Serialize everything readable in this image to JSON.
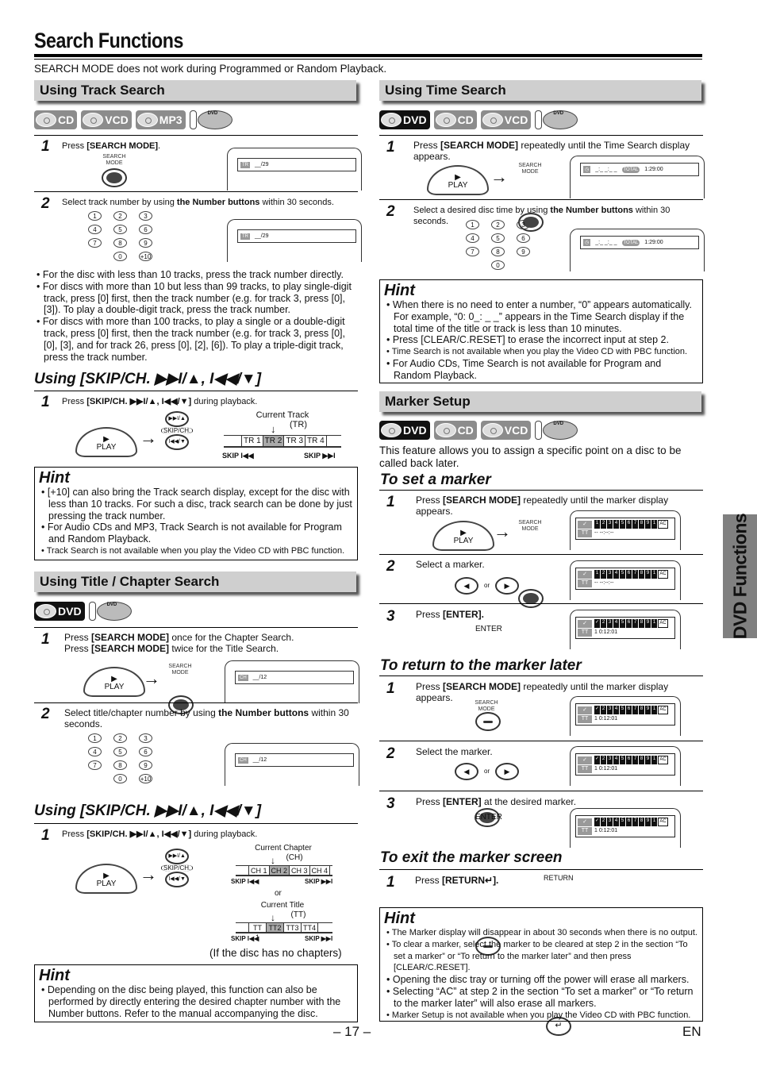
{
  "page": {
    "title": "Search Functions",
    "intro": "SEARCH MODE does not work during Programmed or Random Playback.",
    "side_tab": "DVD Functions",
    "page_number": "– 17 –",
    "language": "EN"
  },
  "discs": {
    "dvd": "DVD",
    "cd": "CD",
    "vcd": "VCD",
    "mp3": "MP3",
    "pad_label": "DVD"
  },
  "buttons": {
    "search_mode": "SEARCH MODE",
    "play": "PLAY",
    "enter": "ENTER",
    "return": "RETURN",
    "skip_ch": "SKIP/CH.",
    "skip_next": "▶▶I/▲",
    "skip_prev": "I◀◀/▼",
    "or": "or",
    "left": "◀",
    "right": "▶",
    "numbers": [
      "1",
      "2",
      "3",
      "4",
      "5",
      "6",
      "7",
      "8",
      "9",
      "0",
      "+10"
    ],
    "numbers_no_plus10": [
      "1",
      "2",
      "3",
      "4",
      "5",
      "6",
      "7",
      "8",
      "9",
      "0"
    ]
  },
  "track_search": {
    "heading": "Using Track Search",
    "step1": {
      "num": "1",
      "text_pre": "Press ",
      "text_bold": "[SEARCH MODE]",
      "text_post": "."
    },
    "step2": {
      "num": "2",
      "text_pre": "Select track number by using ",
      "text_bold": "the Number buttons",
      "text_post": " within 30 seconds."
    },
    "display_tag": "TR",
    "display_value": "__/29",
    "bullets": [
      "For the disc with less than 10 tracks, press the track number directly.",
      "For discs with more than 10 but less than 99 tracks, to play single-digit track, press [0] first, then the track number (e.g. for track 3, press [0], [3]). To play a double-digit track, press the track number.",
      "For discs with more than 100 tracks, to play a single or a double-digit track, press [0] first, then the track number (e.g. for track 3, press [0], [0], [3], and for track 26, press [0], [2], [6]). To play a triple-digit track, press the track number."
    ]
  },
  "skip_track": {
    "heading": "Using [SKIP/CH. ▶▶I/▲, I◀◀/▼]",
    "step1": {
      "num": "1",
      "text_pre": "Press ",
      "text_bold": "[SKIP/CH. ▶▶I/▲, I◀◀/▼]",
      "text_post": " during playback."
    },
    "caption": "Current Track",
    "caption_abbr": "(TR)",
    "cells": [
      "TR 1",
      "TR 2",
      "TR 3",
      "TR 4"
    ],
    "current_index": 1,
    "skip_prev": "SKIP I◀◀",
    "skip_next": "SKIP ▶▶I"
  },
  "hint_track": {
    "title": "Hint",
    "items": [
      "[+10] can also bring the Track search display, except for the disc with less than 10 tracks. For such a disc, track search can be done by just pressing the track number.",
      "For Audio CDs and MP3, Track Search is not available for Program and Random Playback.",
      "Track Search is not available when you play the Video CD with PBC function."
    ]
  },
  "title_chapter": {
    "heading": "Using Title / Chapter Search",
    "step1": {
      "num": "1",
      "line1_pre": "Press ",
      "line1_bold": "[SEARCH MODE]",
      "line1_post": " once for the Chapter Search.",
      "line2_pre": "Press ",
      "line2_bold": "[SEARCH MODE]",
      "line2_post": " twice for the Title Search."
    },
    "step2": {
      "num": "2",
      "text_pre": "Select title/chapter number by using ",
      "text_bold": "the Number buttons",
      "text_post": " within 30 seconds."
    },
    "display_tag": "CH",
    "display_value": "__/12"
  },
  "skip_chapter": {
    "heading": "Using [SKIP/CH. ▶▶I/▲, I◀◀/▼]",
    "step1": {
      "num": "1",
      "text_pre": "Press ",
      "text_bold": "[SKIP/CH. ▶▶I/▲, I◀◀/▼]",
      "text_post": " during playback."
    },
    "chapter_caption": "Current Chapter",
    "chapter_abbr": "(CH)",
    "chapter_cells": [
      "CH 1",
      "CH 2",
      "CH 3",
      "CH 4"
    ],
    "or": "or",
    "title_caption": "Current Title",
    "title_abbr": "(TT)",
    "title_cells": [
      "TT 1",
      "TT2",
      "TT3",
      "TT4"
    ],
    "current_index": 1,
    "skip_prev": "SKIP I◀◀",
    "skip_next": "SKIP ▶▶I",
    "note": "(If the disc has no chapters)"
  },
  "hint_chapter": {
    "title": "Hint",
    "items": [
      "Depending on the disc being played, this function can also be performed by directly entering the desired chapter number with the Number buttons. Refer to the manual accompanying the disc."
    ]
  },
  "time_search": {
    "heading": "Using Time Search",
    "step1": {
      "num": "1",
      "text_pre": "Press ",
      "text_bold": "[SEARCH MODE]",
      "text_post": " repeatedly until the Time Search display appears."
    },
    "step2": {
      "num": "2",
      "text_pre": "Select a desired disc time by using ",
      "text_bold": "the Number buttons",
      "text_post": " within 30 seconds."
    },
    "display_value": "_:_ _:_ _",
    "total_tag": "TOTAL",
    "total_value": "1:29:00"
  },
  "hint_time": {
    "title": "Hint",
    "items": [
      "When there is no need to enter a number, “0” appears automatically. For example, “0: 0_: _ _” appears in the Time Search display if the total time of the title or track is less than 10 minutes.",
      "Press [CLEAR/C.RESET] to erase the incorrect input at step 2.",
      "Time Search is not available when you play the Video CD with PBC function.",
      "For Audio CDs, Time Search is not available for Program and Random Playback."
    ]
  },
  "marker_setup": {
    "heading": "Marker Setup",
    "intro": "This feature allows you to assign a specific point on a disc to be called back later.",
    "slots": [
      "1",
      "2",
      "3",
      "4",
      "5",
      "6",
      "7",
      "8",
      "9",
      "1"
    ],
    "slots_set": [
      "✓",
      "2",
      "3",
      "4",
      "5",
      "6",
      "7",
      "8",
      "9",
      "1"
    ],
    "ac": "AC",
    "tt_tag": "TT",
    "empty_time": "-- --:--:--",
    "set_time": "1  0:12:01",
    "set": {
      "heading": "To set a marker",
      "steps": [
        {
          "num": "1",
          "text_pre": "Press ",
          "text_bold": "[SEARCH MODE]",
          "text_post": " repeatedly until the marker display appears."
        },
        {
          "num": "2",
          "text_pre": "Select a marker.",
          "text_bold": "",
          "text_post": ""
        },
        {
          "num": "3",
          "text_pre": "Press ",
          "text_bold": "[ENTER].",
          "text_post": ""
        }
      ]
    },
    "return": {
      "heading": "To return to the marker later",
      "steps": [
        {
          "num": "1",
          "text_pre": "Press ",
          "text_bold": "[SEARCH MODE]",
          "text_post": " repeatedly until the marker display appears."
        },
        {
          "num": "2",
          "text_pre": "Select the marker.",
          "text_bold": "",
          "text_post": ""
        },
        {
          "num": "3",
          "text_pre": "Press ",
          "text_bold": "[ENTER]",
          "text_post": " at the desired marker."
        }
      ]
    },
    "exit": {
      "heading": "To exit the marker screen",
      "step": {
        "num": "1",
        "text_pre": "Press ",
        "text_bold": "[RETURN↵].",
        "text_post": ""
      }
    }
  },
  "hint_marker": {
    "title": "Hint",
    "items": [
      "The Marker display will disappear in about 30 seconds when there is no output.",
      "To clear a marker, select the marker to be cleared at step 2 in the section “To set a marker” or “To return to the marker later” and then press [CLEAR/C.RESET].",
      "Opening the disc tray or turning off the power will erase all markers.",
      "Selecting “AC” at step 2 in the section “To set a marker” or “To return to the marker later” will also erase all markers.",
      "Marker Setup is not available when you play the Video CD with PBC function."
    ]
  }
}
